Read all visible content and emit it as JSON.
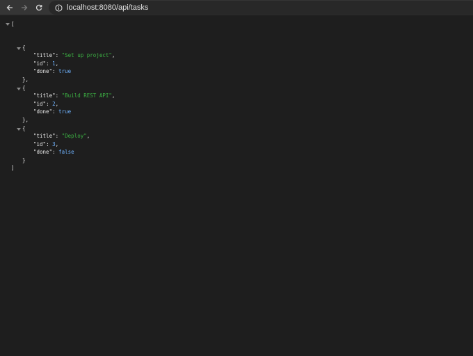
{
  "browser": {
    "url": "localhost:8080/api/tasks"
  },
  "json_view": {
    "open_array": "[",
    "close_array": "]",
    "open_obj": "{",
    "close_obj_comma": "},",
    "close_obj": "}",
    "items": [
      {
        "title_key": "\"title\"",
        "title_val": "\"Set up project\"",
        "id_key": "\"id\"",
        "id_val": "1",
        "done_key": "\"done\"",
        "done_val": "true"
      },
      {
        "title_key": "\"title\"",
        "title_val": "\"Build REST API\"",
        "id_key": "\"id\"",
        "id_val": "2",
        "done_key": "\"done\"",
        "done_val": "true"
      },
      {
        "title_key": "\"title\"",
        "title_val": "\"Deploy\"",
        "id_key": "\"id\"",
        "id_val": "3",
        "done_key": "\"done\"",
        "done_val": "false"
      }
    ]
  }
}
